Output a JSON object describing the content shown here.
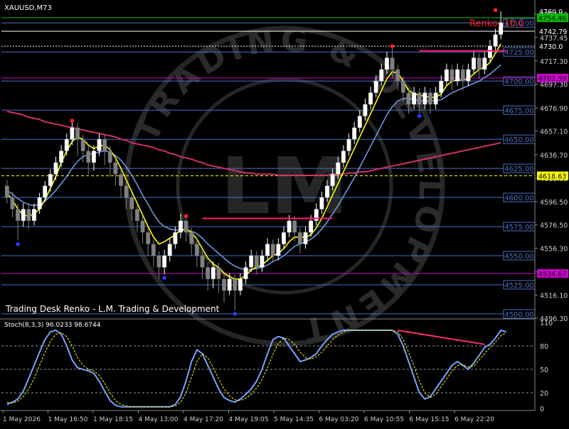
{
  "window": {
    "symbol_label": "XAUUSD,M73",
    "brand": "Trading Desk Renko - L.M. Trading & Development",
    "watermark_text": "TRADING & DEVELOPMENT",
    "watermark_logo": "LM",
    "renko_label": "Renko: 10.0"
  },
  "colors": {
    "background": "#000000",
    "bull_candle": "#ffffff",
    "bear_candle": "#808080",
    "ma_fast": "#ffff00",
    "ma_slow": "#6f96df",
    "ma_long": "#d0306a",
    "sr_line": "#ff1c6c",
    "level_line": "#4a6fbf",
    "stoch_main": "#7aa0ff",
    "stoch_signal": "#ffff00",
    "divergence": "#ff2d6b"
  },
  "chart_data": [
    {
      "type": "candlestick",
      "title": "XAUUSD,M73",
      "ylim": [
        4496.3,
        4766
      ],
      "y_axis_ticks": [
        4757.6,
        4737.45,
        4717.3,
        4697.3,
        4676.9,
        4657.1,
        4636.7,
        4616.55,
        4596.5,
        4576.5,
        4556.3,
        4536.1,
        4516.1,
        4496.3
      ],
      "x_labels": [
        "1 May 2026",
        "1 May 16:50",
        "1 May 18:15",
        "4 May 13:00",
        "4 May 17:20",
        "4 May 19:05",
        "5 May 14:35",
        "6 May 03:20",
        "6 May 10:55",
        "6 May 15:15",
        "6 May 22:20"
      ],
      "level_lines": [
        4750.0,
        4725.0,
        4700.0,
        4675.0,
        4650.0,
        4625.0,
        4600.0,
        4575.0,
        4550.0,
        4525.0,
        4500.0
      ],
      "level_labels": [
        "4750.00",
        "4725.00",
        "4700.00",
        "4675.00",
        "4650.00",
        "4625.00",
        "4600.00",
        "4575.00",
        "4550.00",
        "4525.00",
        "4500.00"
      ],
      "price_tags": [
        {
          "value": 4754.46,
          "text": "4754.46",
          "color": "#00c000"
        },
        {
          "value": 4702.59,
          "text": "4702.59",
          "color": "#d000d0"
        },
        {
          "value": 4618.63,
          "text": "4618.63",
          "color": "#ffff00"
        },
        {
          "value": 4534.67,
          "text": "4534.67",
          "color": "#d000d0"
        }
      ],
      "small_labels": [
        {
          "value": 4760.0,
          "text": "4760.0"
        },
        {
          "value": 4742.79,
          "text": "4742.79"
        },
        {
          "value": 4730.0,
          "text": "4730.0"
        }
      ],
      "candles": [
        [
          4610,
          4600,
          4615,
          4595
        ],
        [
          4600,
          4590,
          4605,
          4583
        ],
        [
          4590,
          4580,
          4595,
          4563
        ],
        [
          4580,
          4590,
          4595,
          4575
        ],
        [
          4590,
          4580,
          4594,
          4573
        ],
        [
          4580,
          4590,
          4595,
          4576
        ],
        [
          4590,
          4600,
          4604,
          4586
        ],
        [
          4600,
          4610,
          4614,
          4596
        ],
        [
          4610,
          4620,
          4624,
          4605
        ],
        [
          4620,
          4630,
          4635,
          4615
        ],
        [
          4630,
          4640,
          4645,
          4626
        ],
        [
          4640,
          4650,
          4655,
          4636
        ],
        [
          4650,
          4660,
          4666,
          4645
        ],
        [
          4660,
          4650,
          4664,
          4636
        ],
        [
          4650,
          4640,
          4654,
          4630
        ],
        [
          4640,
          4630,
          4644,
          4620
        ],
        [
          4630,
          4640,
          4645,
          4623
        ],
        [
          4640,
          4650,
          4655,
          4636
        ],
        [
          4650,
          4640,
          4654,
          4628
        ],
        [
          4640,
          4630,
          4644,
          4618
        ],
        [
          4630,
          4620,
          4634,
          4610
        ],
        [
          4620,
          4610,
          4624,
          4600
        ],
        [
          4610,
          4600,
          4614,
          4590
        ],
        [
          4600,
          4590,
          4604,
          4580
        ],
        [
          4590,
          4580,
          4594,
          4570
        ],
        [
          4580,
          4570,
          4584,
          4560
        ],
        [
          4570,
          4560,
          4574,
          4550
        ],
        [
          4560,
          4550,
          4564,
          4540
        ],
        [
          4550,
          4540,
          4554,
          4530
        ],
        [
          4540,
          4550,
          4555,
          4534
        ],
        [
          4550,
          4560,
          4565,
          4545
        ],
        [
          4560,
          4570,
          4575,
          4556
        ],
        [
          4570,
          4580,
          4586,
          4565
        ],
        [
          4580,
          4570,
          4584,
          4562
        ],
        [
          4570,
          4560,
          4574,
          4550
        ],
        [
          4560,
          4550,
          4564,
          4540
        ],
        [
          4550,
          4540,
          4554,
          4530
        ],
        [
          4540,
          4530,
          4544,
          4520
        ],
        [
          4530,
          4540,
          4545,
          4522
        ],
        [
          4540,
          4530,
          4544,
          4518
        ],
        [
          4530,
          4520,
          4534,
          4510
        ],
        [
          4520,
          4530,
          4535,
          4516
        ],
        [
          4530,
          4520,
          4534,
          4503
        ],
        [
          4520,
          4530,
          4535,
          4516
        ],
        [
          4530,
          4540,
          4545,
          4526
        ],
        [
          4540,
          4550,
          4555,
          4536
        ],
        [
          4550,
          4540,
          4554,
          4534
        ],
        [
          4540,
          4550,
          4555,
          4536
        ],
        [
          4550,
          4560,
          4565,
          4546
        ],
        [
          4560,
          4550,
          4564,
          4544
        ],
        [
          4550,
          4560,
          4565,
          4546
        ],
        [
          4560,
          4570,
          4575,
          4556
        ],
        [
          4570,
          4580,
          4585,
          4566
        ],
        [
          4580,
          4570,
          4584,
          4562
        ],
        [
          4570,
          4560,
          4574,
          4552
        ],
        [
          4560,
          4570,
          4575,
          4556
        ],
        [
          4570,
          4580,
          4585,
          4566
        ],
        [
          4580,
          4590,
          4595,
          4576
        ],
        [
          4590,
          4600,
          4605,
          4586
        ],
        [
          4600,
          4610,
          4615,
          4596
        ],
        [
          4610,
          4620,
          4625,
          4606
        ],
        [
          4620,
          4630,
          4635,
          4616
        ],
        [
          4630,
          4640,
          4645,
          4626
        ],
        [
          4640,
          4650,
          4655,
          4636
        ],
        [
          4650,
          4660,
          4665,
          4646
        ],
        [
          4660,
          4670,
          4675,
          4656
        ],
        [
          4670,
          4680,
          4685,
          4666
        ],
        [
          4680,
          4690,
          4695,
          4676
        ],
        [
          4690,
          4700,
          4705,
          4686
        ],
        [
          4700,
          4710,
          4715,
          4696
        ],
        [
          4710,
          4720,
          4725,
          4706
        ],
        [
          4720,
          4710,
          4730,
          4702
        ],
        [
          4710,
          4700,
          4714,
          4692
        ],
        [
          4700,
          4690,
          4704,
          4682
        ],
        [
          4690,
          4680,
          4694,
          4672
        ],
        [
          4680,
          4690,
          4695,
          4676
        ],
        [
          4690,
          4680,
          4694,
          4672
        ],
        [
          4680,
          4690,
          4695,
          4676
        ],
        [
          4690,
          4680,
          4694,
          4672
        ],
        [
          4680,
          4690,
          4695,
          4676
        ],
        [
          4690,
          4700,
          4705,
          4686
        ],
        [
          4700,
          4710,
          4715,
          4696
        ],
        [
          4710,
          4700,
          4714,
          4692
        ],
        [
          4700,
          4710,
          4715,
          4696
        ],
        [
          4710,
          4700,
          4714,
          4692
        ],
        [
          4700,
          4710,
          4715,
          4696
        ],
        [
          4710,
          4720,
          4725,
          4706
        ],
        [
          4720,
          4710,
          4724,
          4702
        ],
        [
          4710,
          4720,
          4725,
          4706
        ],
        [
          4720,
          4730,
          4735,
          4716
        ],
        [
          4730,
          4740,
          4745,
          4726
        ],
        [
          4740,
          4750,
          4760,
          4736
        ]
      ],
      "series": [
        {
          "name": "",
          "values": [
            4604,
            4598,
            4590,
            4585,
            4584,
            4586,
            4590,
            4598,
            4608,
            4618,
            4630,
            4640,
            4648,
            4652,
            4650,
            4645,
            4642,
            4644,
            4645,
            4641,
            4634,
            4625,
            4615,
            4605,
            4595,
            4585,
            4575,
            4566,
            4560,
            4562,
            4565,
            4568,
            4572,
            4573,
            4570,
            4564,
            4556,
            4548,
            4543,
            4540,
            4535,
            4532,
            4530,
            4530,
            4533,
            4538,
            4540,
            4542,
            4546,
            4550,
            4552,
            4556,
            4562,
            4566,
            4566,
            4566,
            4568,
            4574,
            4582,
            4592,
            4602,
            4612,
            4622,
            4632,
            4642,
            4652,
            4662,
            4672,
            4682,
            4692,
            4702,
            4708,
            4707,
            4700,
            4692,
            4689,
            4688,
            4687,
            4686,
            4686,
            4689,
            4696,
            4700,
            4701,
            4701,
            4702,
            4706,
            4710,
            4712,
            4716,
            4724,
            4732
          ]
        },
        {
          "name": "",
          "values": [
            4606,
            4603,
            4599,
            4596,
            4594,
            4593,
            4594,
            4597,
            4601,
            4606,
            4612,
            4618,
            4625,
            4631,
            4635,
            4637,
            4638,
            4639,
            4640,
            4639,
            4636,
            4632,
            4626,
            4619,
            4611,
            4602,
            4594,
            4586,
            4579,
            4575,
            4573,
            4572,
            4572,
            4572,
            4571,
            4569,
            4565,
            4560,
            4556,
            4552,
            4548,
            4544,
            4541,
            4539,
            4538,
            4538,
            4539,
            4540,
            4542,
            4545,
            4547,
            4550,
            4554,
            4558,
            4560,
            4562,
            4564,
            4568,
            4573,
            4579,
            4586,
            4593,
            4601,
            4609,
            4617,
            4626,
            4635,
            4644,
            4653,
            4662,
            4671,
            4678,
            4683,
            4685,
            4685,
            4684,
            4683,
            4683,
            4683,
            4683,
            4684,
            4687,
            4690,
            4692,
            4694,
            4696,
            4698,
            4700,
            4703,
            4706,
            4710,
            4714
          ]
        },
        {
          "name": "",
          "values": [
            4674,
            4673,
            4672,
            4671,
            4669,
            4668,
            4667,
            4665,
            4664,
            4663,
            4662,
            4661,
            4660,
            4659,
            4658,
            4657,
            4656,
            4655,
            4654,
            4653,
            4652,
            4650,
            4649,
            4647,
            4646,
            4645,
            4644,
            4643,
            4641,
            4640,
            4638,
            4637,
            4635,
            4634,
            4633,
            4631,
            4630,
            4628,
            4627,
            4626,
            4625,
            4624,
            4623,
            4622,
            4621,
            4621,
            4620,
            4620,
            4620,
            4620,
            4619,
            4619,
            4619,
            4619,
            4619,
            4619,
            4619,
            4619,
            4619,
            4619,
            4620,
            4620,
            4620,
            4621,
            4621,
            4622,
            4622,
            4623,
            4624,
            4625,
            4626,
            4627,
            4628,
            4629,
            4630,
            4631,
            4632,
            4633,
            4634,
            4635,
            4636,
            4637,
            4638,
            4639,
            4640,
            4641,
            4642,
            4643,
            4644,
            4645,
            4646,
            4647
          ]
        }
      ],
      "sr_lines": [
        {
          "price": 4726,
          "from_index": 76,
          "to_index": 92
        },
        {
          "price": 4582,
          "from_index": 36,
          "to_index": 60
        }
      ],
      "swing_markers": [
        {
          "index": 12,
          "price": 4666,
          "kind": "high"
        },
        {
          "index": 33,
          "price": 4584,
          "kind": "high"
        },
        {
          "index": 71,
          "price": 4730,
          "kind": "high"
        },
        {
          "index": 90,
          "price": 4761,
          "kind": "high"
        },
        {
          "index": 2,
          "price": 4560,
          "kind": "low"
        },
        {
          "index": 29,
          "price": 4531,
          "kind": "low"
        },
        {
          "index": 42,
          "price": 4500,
          "kind": "low"
        },
        {
          "index": 76,
          "price": 4670,
          "kind": "low"
        }
      ]
    },
    {
      "type": "line",
      "title": "Stoch(8,3,3) 96.0233 98.6744",
      "ylim": [
        0,
        110
      ],
      "y_ticks": [
        110,
        80,
        50,
        20,
        0
      ],
      "levels": [
        80,
        50,
        20
      ],
      "series": [
        {
          "name": "",
          "values": [
            5,
            8,
            12,
            22,
            38,
            55,
            72,
            88,
            98,
            100,
            95,
            80,
            62,
            52,
            50,
            48,
            45,
            35,
            22,
            10,
            4,
            2,
            2,
            2,
            2,
            2,
            2,
            2,
            2,
            2,
            2,
            5,
            15,
            35,
            60,
            75,
            70,
            55,
            40,
            25,
            14,
            10,
            8,
            12,
            18,
            25,
            35,
            50,
            70,
            88,
            92,
            90,
            80,
            70,
            60,
            62,
            65,
            70,
            80,
            88,
            95,
            98,
            100,
            100,
            100,
            100,
            100,
            100,
            100,
            100,
            100,
            100,
            95,
            80,
            60,
            40,
            20,
            12,
            15,
            25,
            35,
            45,
            55,
            60,
            55,
            50,
            58,
            68,
            78,
            82,
            90,
            100,
            98
          ]
        },
        {
          "name": "",
          "values": [
            8,
            7,
            9,
            15,
            25,
            38,
            55,
            72,
            86,
            95,
            97,
            92,
            80,
            65,
            55,
            50,
            48,
            42,
            32,
            20,
            10,
            5,
            3,
            2,
            2,
            2,
            2,
            2,
            2,
            2,
            2,
            3,
            8,
            20,
            40,
            60,
            70,
            65,
            52,
            38,
            25,
            16,
            11,
            10,
            13,
            18,
            26,
            37,
            52,
            69,
            83,
            90,
            88,
            82,
            72,
            65,
            63,
            66,
            72,
            80,
            88,
            94,
            98,
            100,
            100,
            100,
            100,
            100,
            100,
            100,
            100,
            100,
            98,
            88,
            72,
            54,
            35,
            20,
            14,
            18,
            28,
            38,
            48,
            55,
            56,
            53,
            54,
            62,
            70,
            78,
            85,
            93,
            97
          ]
        }
      ],
      "divergence": {
        "from_index": 72,
        "from_value": 100,
        "to_index": 88,
        "to_value": 82
      }
    }
  ]
}
